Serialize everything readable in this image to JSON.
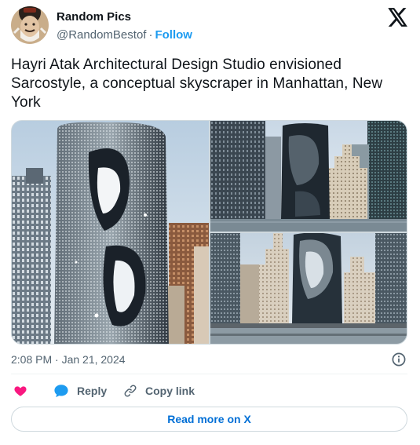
{
  "author": {
    "display_name": "Random Pics",
    "handle": "@RandomBestof",
    "separator": "·",
    "follow_label": "Follow"
  },
  "tweet": {
    "text": "Hayri Atak Architectural Design Studio envisioned Sarcostyle, a conceptual skyscraper in Manhattan, New York",
    "timestamp": "2:08 PM · Jan 21, 2024"
  },
  "actions": {
    "reply_label": "Reply",
    "copy_link_label": "Copy link",
    "read_more_label": "Read more on X"
  },
  "icons": {
    "brand": "x-logo-icon",
    "info": "info-icon",
    "like": "heart-icon",
    "reply": "speech-bubble-icon",
    "copy": "link-icon"
  },
  "colors": {
    "accent": "#1d9bf0",
    "like": "#f91880",
    "text_secondary": "#536471",
    "read_more": "#006fd6"
  },
  "media": {
    "image_count": 3
  }
}
